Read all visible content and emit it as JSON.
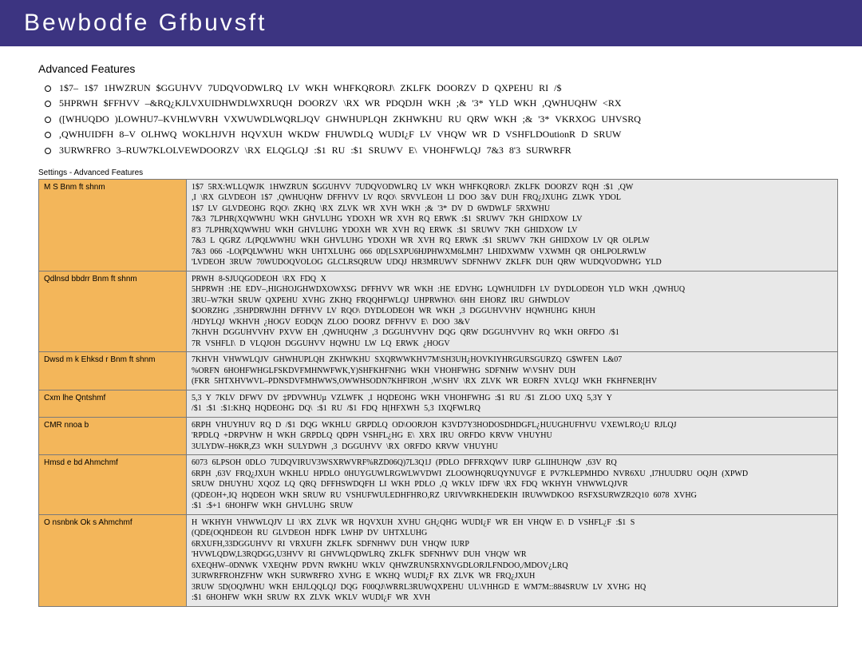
{
  "header": {
    "title": "Bewbodfe   Gfbuvsft"
  },
  "section_title": "Advanced Features",
  "bullets": [
    "1$7– 1$7  1HWZRUN $GGUHVV 7UDQVODWLRQ  LV WKH WHFKQRORJ\\ ZKLFK DOORZV D QXPEHU RI /$",
    "5HPRWH $FFHVV –&RQ¿KJLVXUIDHWDLWXRUQH DOORZV \\RX WR PDQDJH WKH ;&  '3*   YLD WKH ,QWHUQHW  <RX",
    "([WHUQDO )LOWHU7–KVHLWVRH VXWUWDLWQRLJQV  GHWHUPLQH ZKHWKHU RU QRW WKH ;& '3*   VKRXOG UHVSRQ",
    ",QWHUIDFH 8–V OLHWQ WOKLHJVH HQVXUH WKDW FHUWDLQ WUDI¿F LV VHQW WR D VSHFLDOutionR D SRUW",
    "3URWRFRO 3–RUW7KLOLVEWDOORZV \\RX ELQGLQJ :$1  RU :$1  SRUWV E\\ VHOHFWLQJ 7&3 8'3 SURWRFR"
  ],
  "table_caption": "Settings - Advanced Features",
  "rows": [
    {
      "label": "M S Bnm ft shnm",
      "lines": [
        "1$7 5RX:WLLQWJK 1HWZRUN $GGUHVV 7UDQVODWLRQ LV WKH WHFKQRORJ\\ ZKLFK DOORZV RQH  :$1 ,QW",
        ",I \\RX GLVDEOH 1$7  ,QWHUQHW DFFHVV LV RQO\\ SRVVLEOH LI DOO 3&V DUH FRQ¿JXUHG ZLWK YDOL",
        "1$7 LV GLVDEOHG RQO\\ ZKHQ \\RX ZLVK WR XVH WKH ;& '3*   DV D 6WDWLF 5RXWHU",
        "7&3 7LPHR(XQWWHU WKH GHVLUHG YDOXH WR XVH RQ ERWK :$1 SRUWV  7KH GHIDXOW LV",
        "8'3 7LPHR(XQWWHU WKH GHVLUHG YDOXH WR XVH RQ ERWK :$1 SRUWV  7KH GHIDXOW LV",
        "7&3  L QGRZ /L(PQLWWHU WKH GHVLUHG YDOXH WR XVH RQ ERWK :$1 SRUWV 7KH GHIDXOW LV   QR OLPLW",
        "7&3 066  -LO(PQLWWHU WKH UHTXLUHG 066  0D[LSXPU6HJPHWXM6LMH7 LHIDXWMW VXWMH  QR OHLPOLRWLW",
        "'LVDEOH 3RUW  70WUDOQVOLOG GLCLRSQRUW UDQJ HR3MRUWV SDFNHWV ZKLFK DUH QRW WUDQVODWHG YLD"
      ]
    },
    {
      "label": "Qdlnsd bbdrr Bnm ft shnm",
      "lines": [
        "PRWH 8-SJUQGODEOH  \\RX FDQ X",
        "5HPRWH :HE EDV–,HIGHOJGHWDXOWXSG  DFFHVV WR WKH :HE EDVHG LQWHUIDFH LV DYDLODEOH YLD WKH ,QWHUQ",
        "3RU–W7KH SRUW QXPEHU XVHG ZKHQ FRQQHFWLQJ UHPRWHO\\  6HH EHORZ IRU GHWDLOV",
        "$OORZHG ,35HPDRWJHH DFFHVV LV RQO\\ DYDLODEOH WR WKH ,3 DGGUHVVHV HQWHUHG KHUH",
        "/HDYLQJ WKHVH ¿HOGV EODQN ZLOO DOORZ DFFHVV E\\ DOO 3&V",
        "7KHVH DGGUHVVHV PXVW EH ,QWHUQHW ,3 DGGUHVVHV DQG QRW DGGUHVVHV RQ WKH ORFDO /$1",
        "7R VSHFLI\\ D VLQJOH DGGUHVV  HQWHU LW LQ ERWK ¿HOGV"
      ]
    },
    {
      "label": "Dwsd m k Ehksd r Bnm ft shnm",
      "lines": [
        "7KHVH VHWWLQJV GHWHUPLQH ZKHWKHU SXQRWWKHV7M\\SH3UH¿HOVKIYHRGURSGURZQ G$WFEN L&07",
        "%ORFN 6HOHFWHGLFSKDVFMHNWFWK,Y)SHFKHFNHG  WKH VHOHFWHG SDFNHW W\\VSHV DUH",
        "(FKR 5HTXHVWVL–PDNSDVFMHWWS,OWWHSODN7KHFIROH ,W\\SHV \\RX ZLVK WR EORFN  XVLQJ WKH FKHFNER[HV"
      ]
    },
    {
      "label": "Cxm lhe Qntshmf",
      "lines": [
        "5,3 Y 7KLV DFWV DV ‡PDVWHUµ VZLWFK ,I HQDEOHG  WKH VHOHFWHG :$1 RU /$1 ZLOO UXQ 5,3Y  Y",
        "/$1  :$1  :$1:KHQ HQDEOHG  DQ\\ :$1 RU /$1 FDQ H[HFXWH 5,3 IXQFWLRQ"
      ]
    },
    {
      "label": "CMR nnoa b",
      "lines": [
        "6RPH VHUYHUV RQ D /$1 DQG WKHLU GRPDLQ OD\\OORJOH K3VD7Y3HODOSDHDGFL¿HUUGHUFHVU VXEWLRO¿U  RJLQJ",
        "'RPDLQ +DRPVHW H WKH GRPDLQ QDPH VSHFL¿HG E\\ XRX IRU ORFDO KRVW VHUYHU",
        "3ULYDW–H6KR,Z3 WKH SULYDWH ,3 DGGUHVV \\RX ORFDO KRVW VHUYHU"
      ]
    },
    {
      "label": "Hmsd e bd Ahmchmf",
      "lines": [
        "6073  6LPSOH 0DLO 7UDQVIRUV3WSXRWVRF%RZD06Q)7L3Q1J (PDLO DFFRXQWV IURP GLIIHUHQW ,63V RQ",
        "6RPH ,63V FRQ¿JXUH WKHLU HPDLO 0HUYGUWLRGWLWVDWI ZLOOWHQRUQYNUVGF E PV7KLEPMHDO NVR6XU ,I7HUUDRU OQJH (XPWD",
        "SRUW DHUYHU XQOZ LQ QRQ DFFHSWDQFH LI WKH PDLO  ,Q WKLV IDFW \\RX FDQ WKHYH VHWWLQJVR",
        "(QDEOH+,IQ HQDEOH  WKH SRUW RU VSHUFWULEDHFHRO,RZ URIVWRKHEDEKIH IRUWWDKOO  RSFXSURWZR2Q10 6078 XVHG",
        ":$1  :$+1 6HOHFW WKH GHVLUHG SRUW"
      ]
    },
    {
      "label": "O nsnbnk Ok s Ahmchmf",
      "lines": [
        "H WKHYH VHWWLQJV LI \\RX ZLVK WR HQVXUH XVHU GH¿QHG WUDI¿F WR EH VHQW E\\ D VSHFL¿F :$1 S",
        "(QDE(OQHDEOH RU GLVDEOH HDFK LWHP DV UHTXLUHG",
        "6RXUFH,33DGGUHVV RI VRXUFH ZKLFK SDFNHWV DUH VHQW IURP",
        "'HVWLQDW,L3RQDGG,U3HVV RI GHVWLQDWLRQ ZKLFK SDFNHWV DUH VHQW WR",
        "6XEQHW–0DNWK VXEQHW PDVN RWKHU WKLV QHWZRUN5RXNVGDLORJLFNDOO,/MDOV¿LRQ",
        "3URWRFROHZFHW WKH SURWRFRO XVHG  E WKHQ WUDI¿F RX ZLVK WR FRQ¿JXUH",
        "3RUW 5D(OQJWHU WKH EHJLQQLQJ DQG F00QJ\\WRRL3RUWQXPEHU UL\\VHHGD E WM7M::884SRUW LV XVHG  HQ",
        ":$1 6HOHFW WKH SRUW RX ZLVK WKLV WUDI¿F WR XVH"
      ]
    }
  ]
}
